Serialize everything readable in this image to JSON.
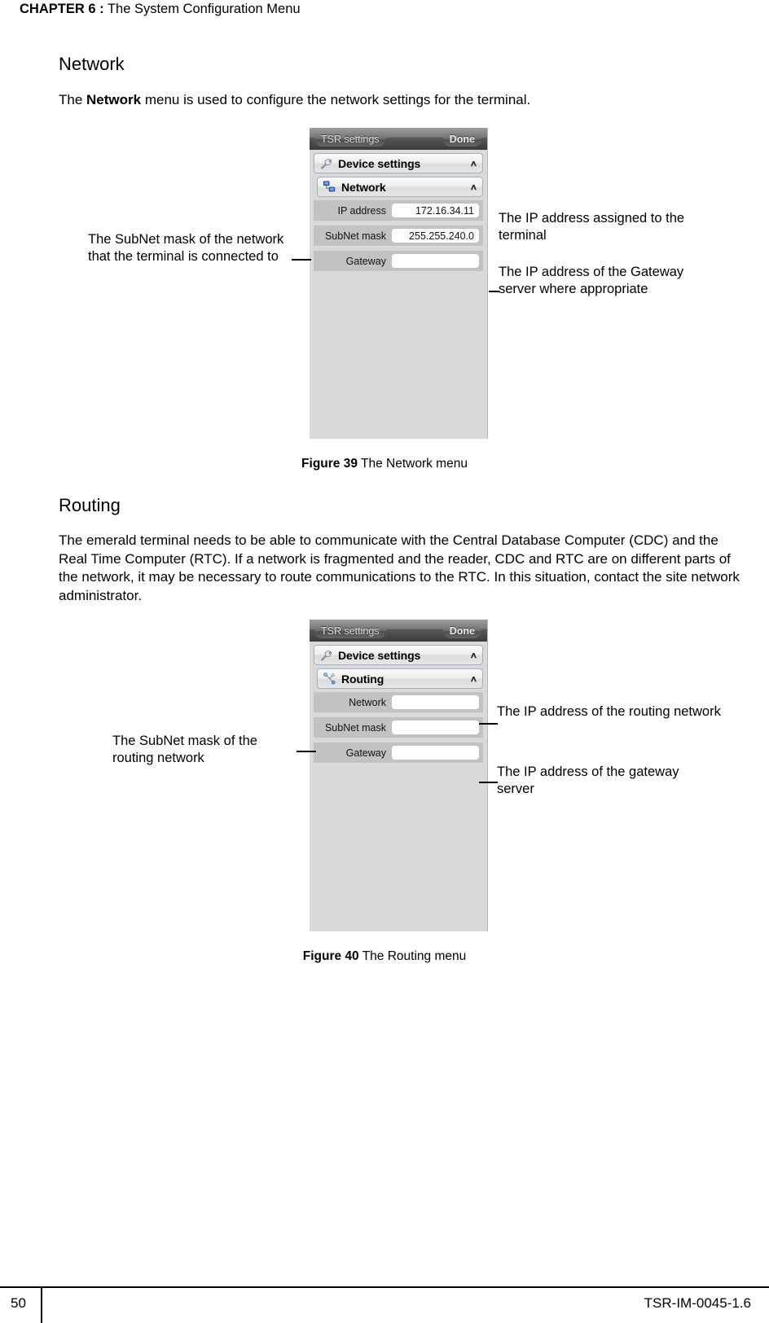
{
  "running_head": {
    "chapter_word": "CHAPTER",
    "chapter_number": "6",
    "colon": ":",
    "title": "The System Configuration Menu"
  },
  "sections": [
    {
      "heading": "Network",
      "paragraph_before": "The ",
      "paragraph_bold": "Network",
      "paragraph_after": " menu is used to configure the network settings for the terminal."
    },
    {
      "heading": "Routing",
      "paragraph": "The emerald terminal needs to be able to communicate with the Central Database Computer (CDC) and the Real Time Computer (RTC). If a network is fragmented and the reader, CDC and RTC are on different parts of the network, it may be necessary to route communications to the RTC. In this situation, contact the site network administrator."
    }
  ],
  "figure_network": {
    "titlebar": {
      "left_button": "TSR settings",
      "right_button": "Done"
    },
    "menus": [
      {
        "label": "Device settings",
        "icon": "wrench-icon",
        "chevron": "∧"
      },
      {
        "label": "Network",
        "icon": "network-computers-icon",
        "chevron": "∧"
      }
    ],
    "fields": [
      {
        "label": "IP address",
        "value": "172.16.34.11"
      },
      {
        "label": "SubNet mask",
        "value": "255.255.240.0"
      },
      {
        "label": "Gateway",
        "value": ""
      }
    ],
    "caption_label": "Figure 39",
    "caption_text": "The Network menu",
    "callouts": {
      "left": "The SubNet mask of the network that the terminal is connected to",
      "right_top": "The IP address assigned to the terminal",
      "right_bottom": "The IP address of the Gateway server where appropriate"
    }
  },
  "figure_routing": {
    "titlebar": {
      "left_button": "TSR settings",
      "right_button": "Done"
    },
    "menus": [
      {
        "label": "Device settings",
        "icon": "wrench-icon",
        "chevron": "∧"
      },
      {
        "label": "Routing",
        "icon": "routing-nodes-icon",
        "chevron": "∧"
      }
    ],
    "fields": [
      {
        "label": "Network",
        "value": ""
      },
      {
        "label": "SubNet mask",
        "value": ""
      },
      {
        "label": "Gateway",
        "value": ""
      }
    ],
    "caption_label": "Figure 40",
    "caption_text": "The Routing menu",
    "callouts": {
      "left": "The SubNet mask of the routing network",
      "right_top": "The IP address of the routing network",
      "right_bottom": "The IP address of the gateway server"
    }
  },
  "footer": {
    "page_number": "50",
    "document_code": "TSR-IM-0045-1.6"
  }
}
